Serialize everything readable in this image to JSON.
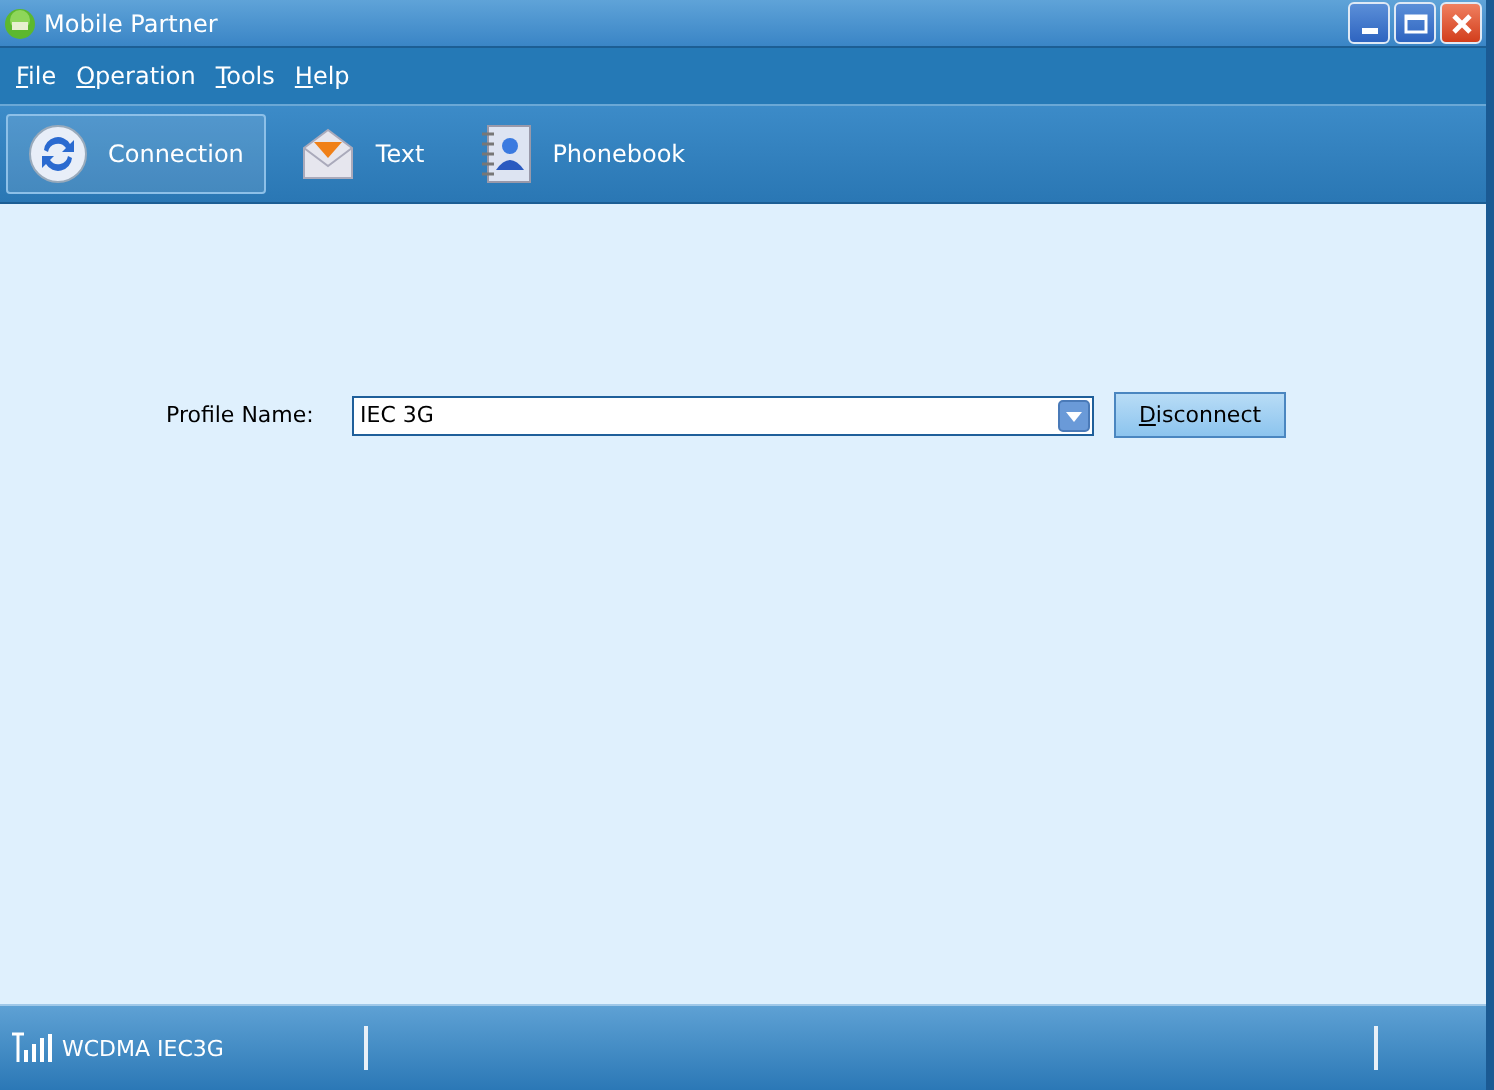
{
  "window": {
    "title": "Mobile Partner"
  },
  "menu": [
    {
      "label": "File"
    },
    {
      "label": "Operation"
    },
    {
      "label": "Tools"
    },
    {
      "label": "Help"
    }
  ],
  "toolbar": [
    {
      "kind": "connection",
      "label": "Connection",
      "selected": true
    },
    {
      "kind": "text",
      "label": "Text",
      "selected": false
    },
    {
      "kind": "phonebook",
      "label": "Phonebook",
      "selected": false
    }
  ],
  "profile": {
    "label": "Profile Name:",
    "value": "IEC 3G"
  },
  "disconnect_button": "Disconnect",
  "status_bar": {
    "network": "WCDMA IEC3G"
  }
}
